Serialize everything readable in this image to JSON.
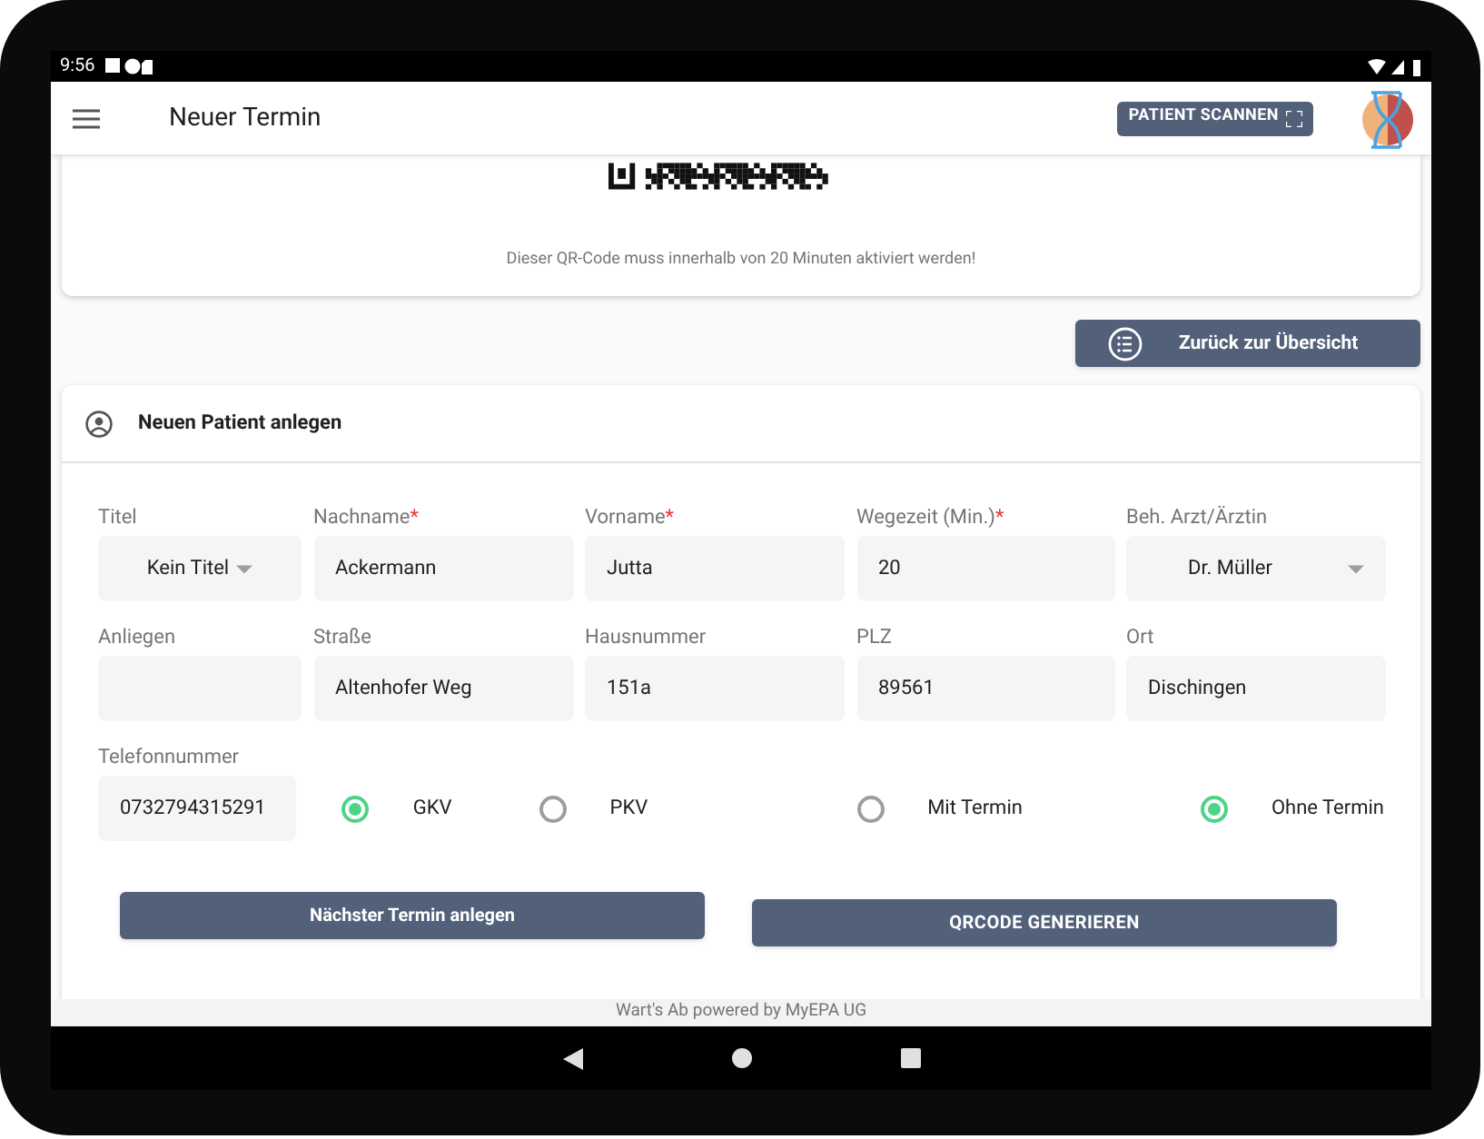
{
  "status_bar": {
    "time": "9:56"
  },
  "app_bar": {
    "title": "Neuer Termin",
    "scan_button": "PATIENT SCANNEN"
  },
  "qr_card": {
    "note": "Dieser QR-Code muss innerhalb von 20 Minuten aktiviert werden!"
  },
  "back_button": "Zurück zur Übersicht",
  "patient_card": {
    "title": "Neuen Patient anlegen",
    "fields": [
      {
        "label": "Titel",
        "kind": "select",
        "value": "Kein Titel"
      },
      {
        "label": "Nachname",
        "required_mark": "*",
        "kind": "text",
        "value": "Ackermann"
      },
      {
        "label": "Vorname",
        "required_mark": "*",
        "kind": "text",
        "value": "Jutta"
      },
      {
        "label": "Wegezeit (Min.)",
        "required_mark": "*",
        "kind": "text",
        "value": "20"
      },
      {
        "label": "Beh. Arzt/Ärztin",
        "kind": "select",
        "value": "Dr. Müller"
      },
      {
        "label": "Anliegen",
        "kind": "text"
      },
      {
        "label": "Straße",
        "kind": "text",
        "value": "Altenhofer Weg"
      },
      {
        "label": "Hausnummer",
        "kind": "text",
        "value": "151a"
      },
      {
        "label": "PLZ",
        "kind": "text",
        "value": "89561"
      },
      {
        "label": "Ort",
        "kind": "text",
        "value": "Dischingen"
      },
      {
        "label": "Telefonnummer",
        "kind": "text",
        "value": "0732794315291"
      }
    ],
    "insurance": [
      {
        "label": "GKV",
        "selected": true
      },
      {
        "label": "PKV",
        "selected": false
      }
    ],
    "appointment": [
      {
        "label": "Mit Termin",
        "selected": false
      },
      {
        "label": "Ohne Termin",
        "selected": true
      }
    ],
    "buttons": [
      "Nächster Termin anlegen",
      "QRCODE GENERIEREN"
    ]
  },
  "footer": "Wart's Ab powered by MyEPA UG"
}
